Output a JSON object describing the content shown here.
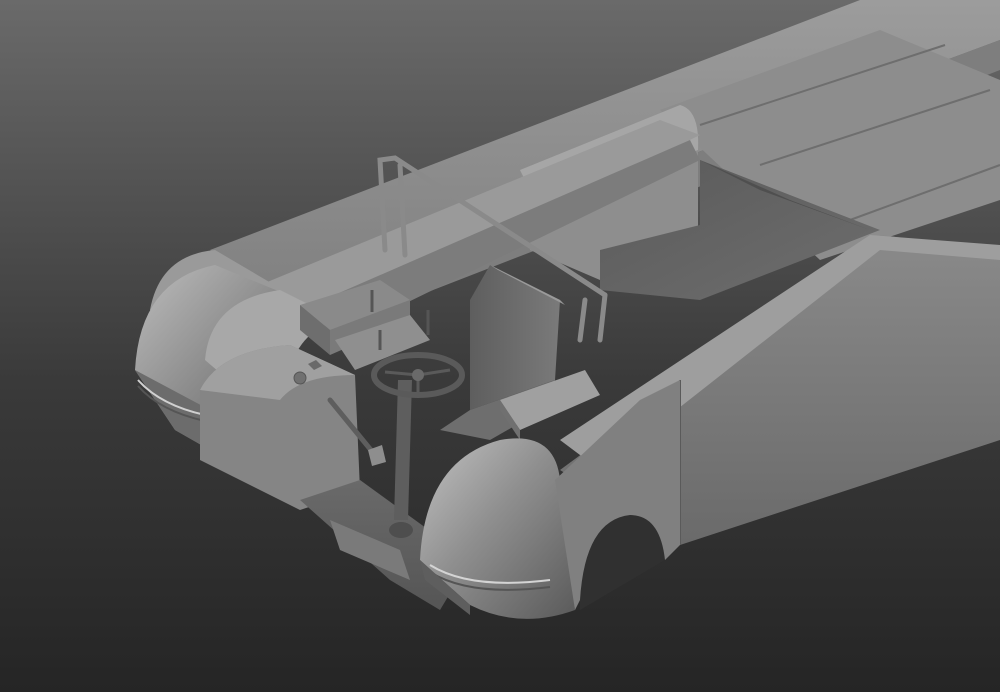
{
  "viewport": {
    "background_top": "#6d6d6d",
    "background_bottom": "#262626",
    "model_base_color": "#8a8a8a",
    "model_highlight_color": "#b8b8b8",
    "model_shadow_color": "#4a4a4a"
  },
  "scene": {
    "subject": "vehicle-body-3d-model",
    "shading": "grey-clay-render"
  }
}
